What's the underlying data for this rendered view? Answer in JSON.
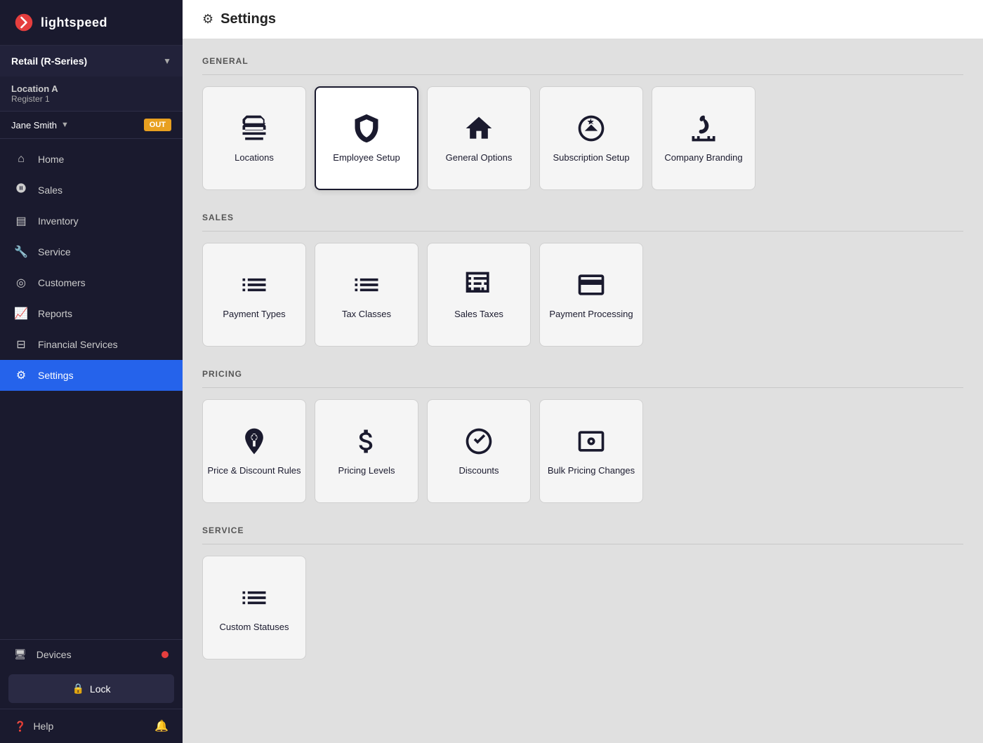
{
  "app": {
    "logo_text": "lightspeed",
    "store_name": "Retail (R-Series)",
    "location_name": "Location A",
    "register_name": "Register 1",
    "user_name": "Jane Smith",
    "user_status": "OUT",
    "page_title": "Settings"
  },
  "sidebar": {
    "nav_items": [
      {
        "id": "home",
        "label": "Home",
        "icon": "🏠",
        "active": false
      },
      {
        "id": "sales",
        "label": "Sales",
        "icon": "👤",
        "active": false
      },
      {
        "id": "inventory",
        "label": "Inventory",
        "icon": "📦",
        "active": false
      },
      {
        "id": "service",
        "label": "Service",
        "icon": "🔧",
        "active": false
      },
      {
        "id": "customers",
        "label": "Customers",
        "icon": "👥",
        "active": false
      },
      {
        "id": "reports",
        "label": "Reports",
        "icon": "📈",
        "active": false
      },
      {
        "id": "financial",
        "label": "Financial Services",
        "icon": "💳",
        "active": false
      },
      {
        "id": "settings",
        "label": "Settings",
        "icon": "⚙️",
        "active": true
      }
    ],
    "devices_label": "Devices",
    "lock_label": "Lock",
    "help_label": "Help"
  },
  "sections": {
    "general": {
      "title": "GENERAL",
      "cards": [
        {
          "id": "locations",
          "label": "Locations",
          "active": false
        },
        {
          "id": "employee-setup",
          "label": "Employee Setup",
          "active": true
        },
        {
          "id": "general-options",
          "label": "General Options",
          "active": false
        },
        {
          "id": "subscription-setup",
          "label": "Subscription Setup",
          "active": false
        },
        {
          "id": "company-branding",
          "label": "Company Branding",
          "active": false
        }
      ]
    },
    "sales": {
      "title": "SALES",
      "cards": [
        {
          "id": "payment-types",
          "label": "Payment Types",
          "active": false
        },
        {
          "id": "tax-classes",
          "label": "Tax Classes",
          "active": false
        },
        {
          "id": "sales-taxes",
          "label": "Sales Taxes",
          "active": false
        },
        {
          "id": "payment-processing",
          "label": "Payment Processing",
          "active": false
        }
      ]
    },
    "pricing": {
      "title": "PRICING",
      "cards": [
        {
          "id": "price-discount-rules",
          "label": "Price & Discount Rules",
          "active": false
        },
        {
          "id": "pricing-levels",
          "label": "Pricing Levels",
          "active": false
        },
        {
          "id": "discounts",
          "label": "Discounts",
          "active": false
        },
        {
          "id": "bulk-pricing-changes",
          "label": "Bulk Pricing Changes",
          "active": false
        }
      ]
    },
    "service": {
      "title": "SERVICE",
      "cards": [
        {
          "id": "custom-statuses",
          "label": "Custom Statuses",
          "active": false
        }
      ]
    }
  }
}
